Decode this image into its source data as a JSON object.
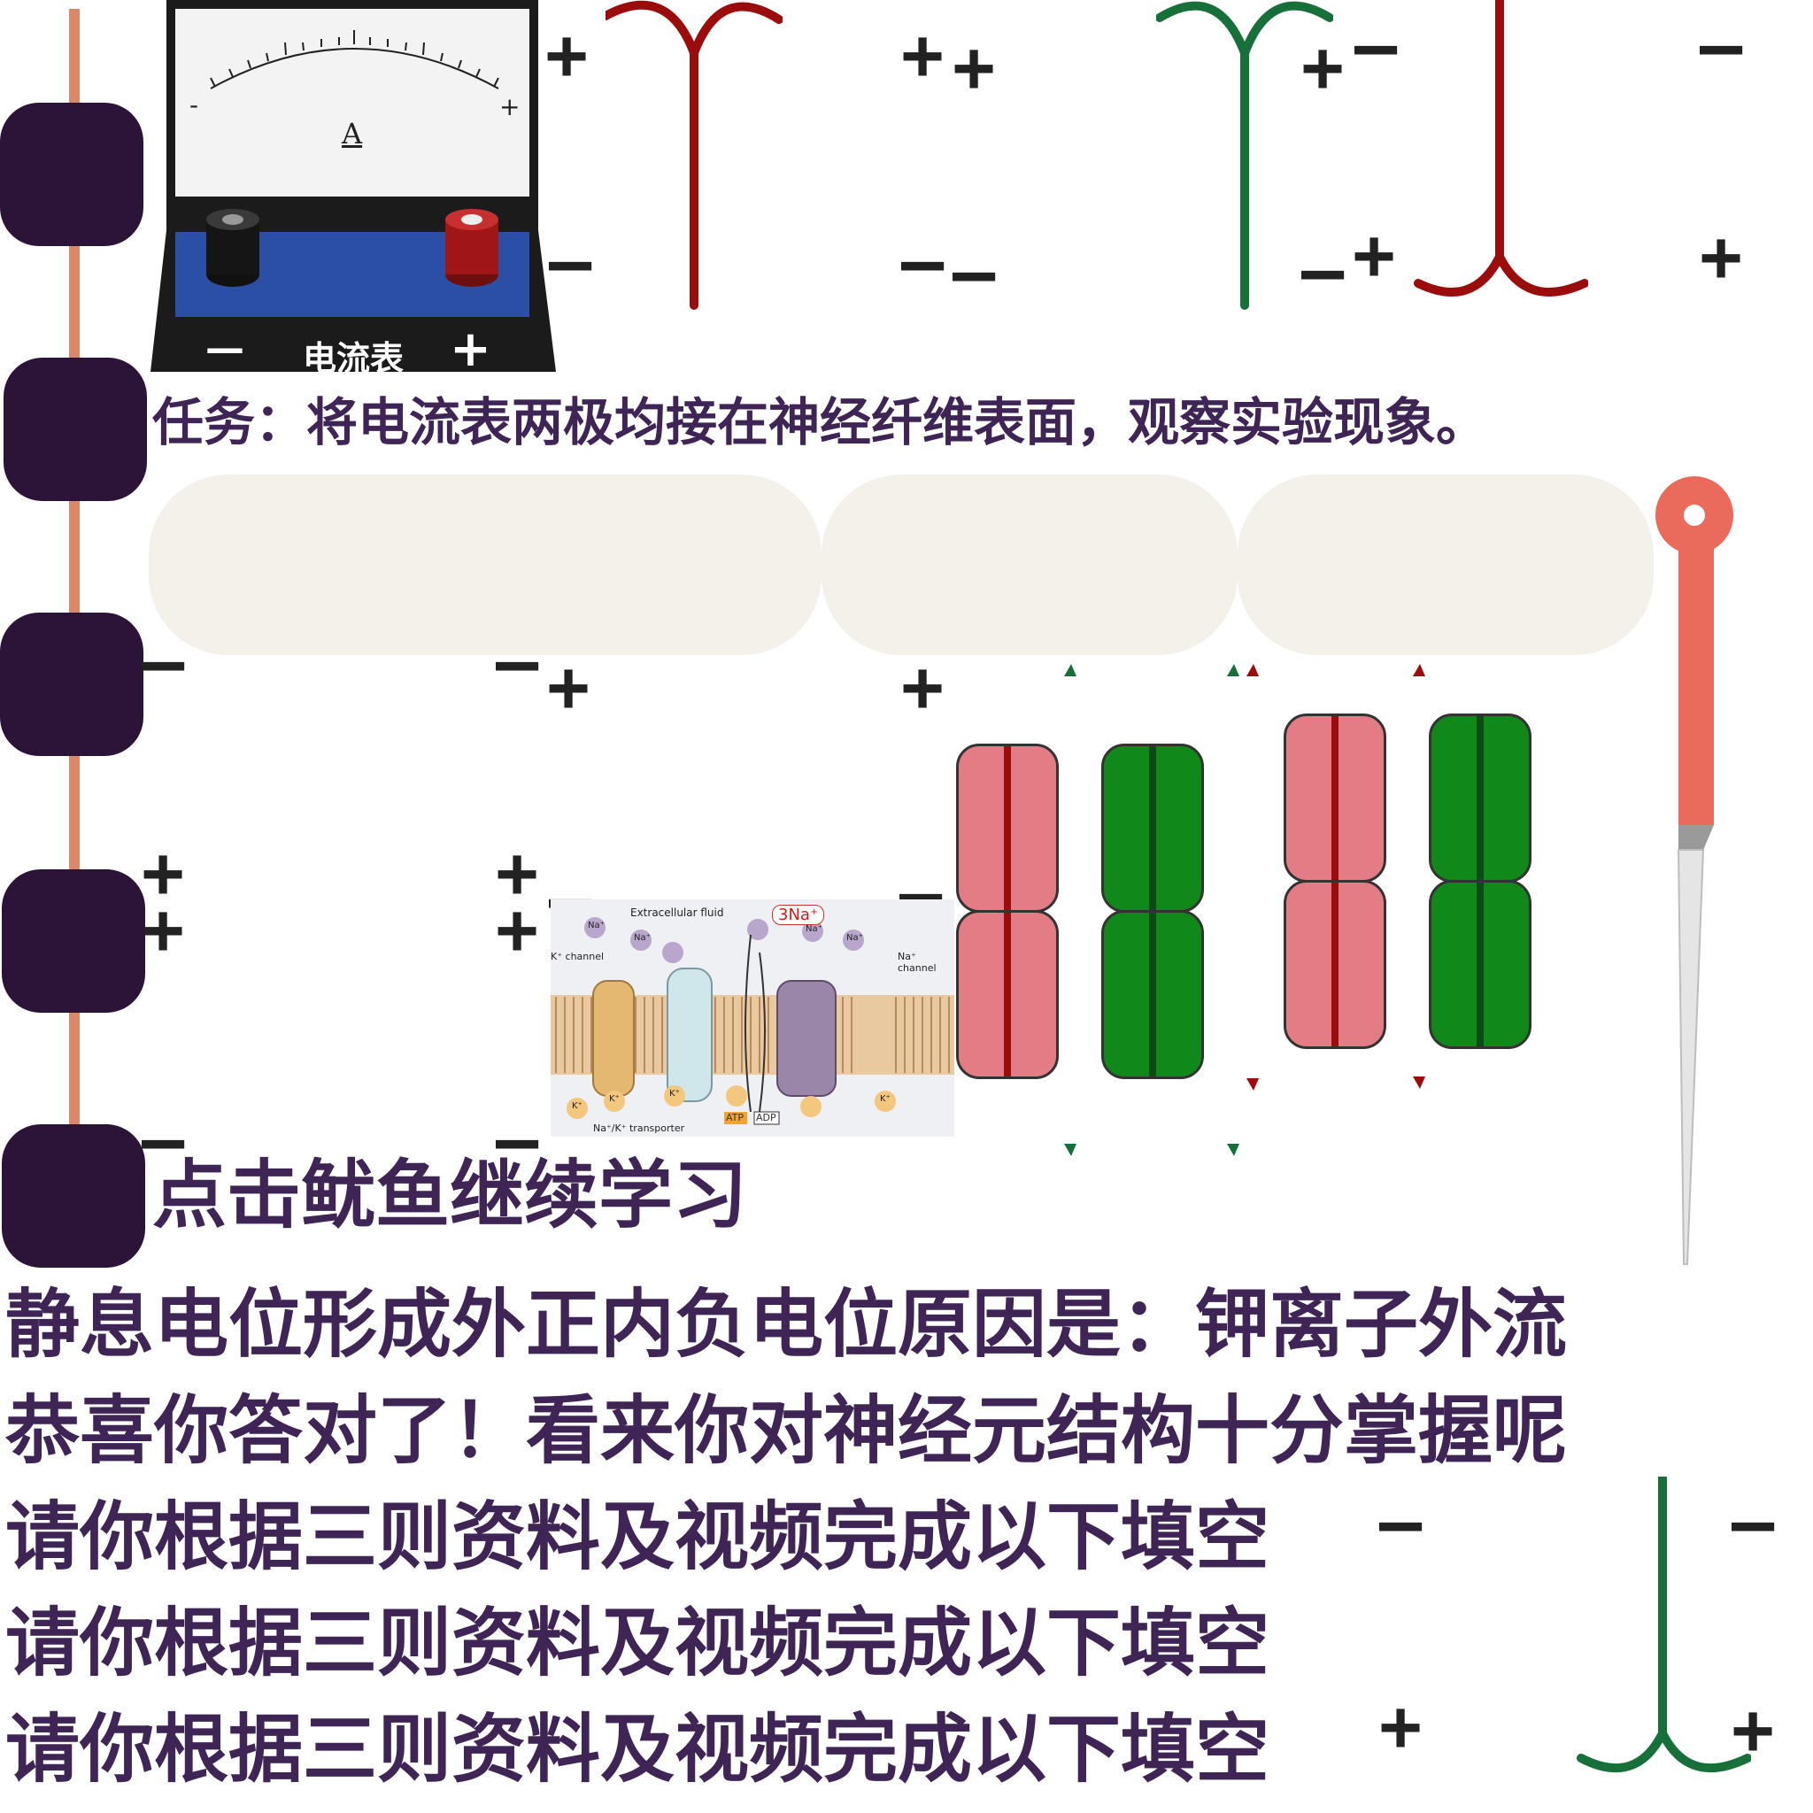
{
  "ammeter": {
    "dial_unit": "A",
    "dial_minus": "-",
    "dial_plus": "+",
    "base_minus": "—",
    "base_label": "电流表",
    "base_plus": "+"
  },
  "texts": {
    "task": "任务：将电流表两极均接在神经纤维表面，观察实验现象。",
    "click_squid": "点击鱿鱼继续学习",
    "resting_reason": "静息电位形成外正内负电位原因是：钾离子外流",
    "congrats": "恭喜你答对了！看来你对神经元结构十分掌握呢",
    "fill_prompt_1": "请你根据三则资料及视频完成以下填空",
    "fill_prompt_2": "请你根据三则资料及视频完成以下填空",
    "fill_prompt_3": "请你根据三则资料及视频完成以下填空"
  },
  "pump_diagram": {
    "extracellular_label": "Extracellular fluid",
    "k_channel_label": "K⁺ channel",
    "na_channel_label": "Na⁺ channel",
    "three_na_label": "3Na⁺",
    "atp_label": "ATP",
    "adp_label": "ADP",
    "transporter_label": "Na⁺/K⁺ transporter",
    "na_ion": "Na⁺",
    "k_ion": "K⁺"
  },
  "signs": {
    "plus": "+",
    "minus": "—"
  },
  "colors": {
    "purple": "#3f2456",
    "dark_blob": "#2c1338",
    "red_electrode": "#9b0d0d",
    "green_electrode": "#17703a",
    "pink_channel": "#e47c86",
    "green_channel": "#11891a",
    "fiber": "#f4f1ea",
    "needle_red": "#ea6a5c",
    "orange_rod": "#d9896a"
  }
}
